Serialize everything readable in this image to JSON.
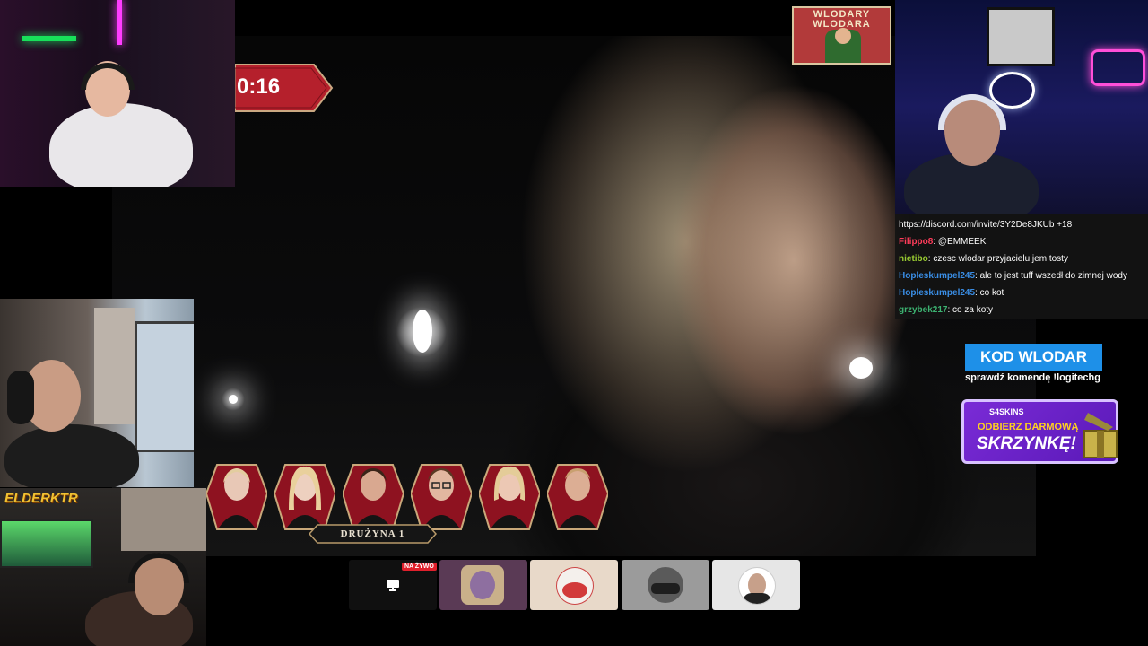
{
  "timer": {
    "value": "0:16"
  },
  "logo": {
    "text": "WLODARY\nWLODARA"
  },
  "chat": {
    "messages": [
      {
        "user": "",
        "text": "https://discord.com/invite/3Y2De8JKUb +18",
        "color": "#ffffff"
      },
      {
        "user": "Filippo8",
        "text": ": @EMMEEK",
        "color": "#ff3c5a"
      },
      {
        "user": "nietibo",
        "text": ": czesc wlodar przyjacielu jem tosty",
        "color": "#9acd32"
      },
      {
        "user": "Hopleskumpel245",
        "text": ": ale to jest tuff wszedł do zimnej wody",
        "color": "#3a8ee6"
      },
      {
        "user": "Hopleskumpel245",
        "text": ": co kot",
        "color": "#3a8ee6"
      },
      {
        "user": "grzybek217",
        "text": ": co za koty",
        "color": "#3cb371"
      }
    ]
  },
  "sponsor": {
    "code_label": "KOD WLODAR",
    "command_hint": "sprawdź komendę !logitechg",
    "promo_brand": "S4SKINS",
    "promo_line1": "ODBIERZ DARMOWĄ",
    "promo_line2": "SKRZYNKĘ!"
  },
  "team": {
    "label": "DRUŻYNA 1"
  },
  "tiles": {
    "live_badge": "NA ŻYWO"
  },
  "elder": {
    "text": "ELDERKTR"
  },
  "colors": {
    "accent_red": "#b5202c",
    "chat_bg": "#141414",
    "sponsor_blue": "#1e90e8",
    "promo_purple": "#7a2bd6"
  },
  "icons": [
    "monitor-icon",
    "gift-box-icon"
  ]
}
